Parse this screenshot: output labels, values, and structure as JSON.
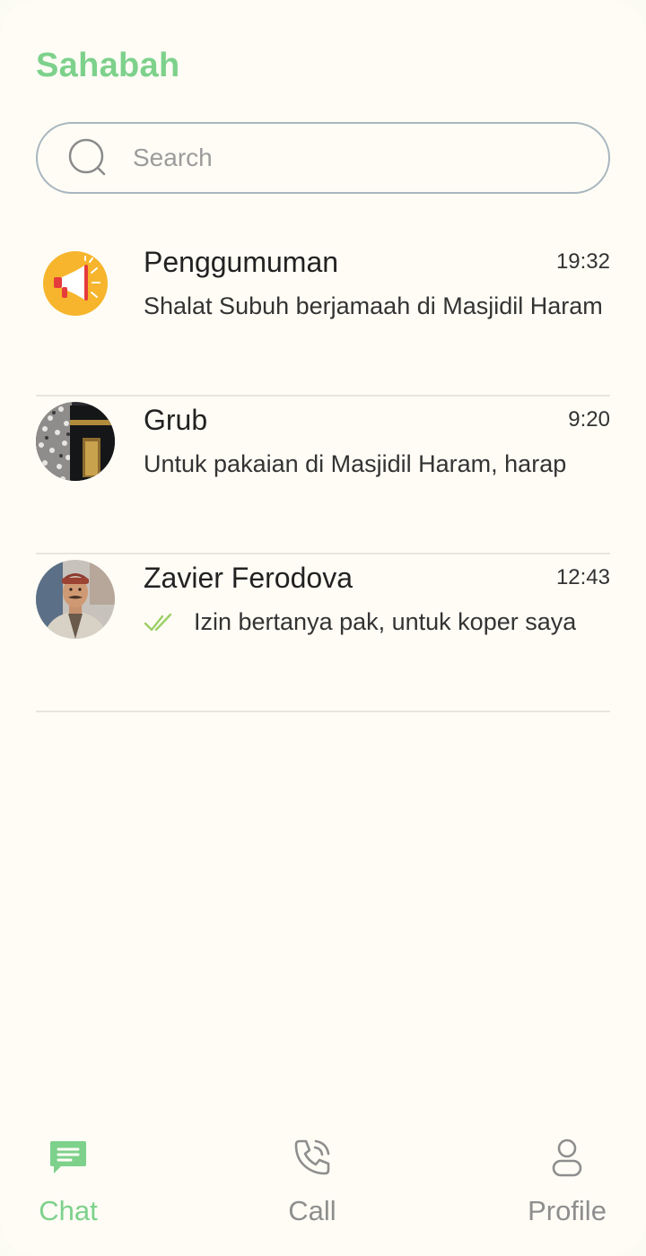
{
  "app": {
    "title": "Sahabah"
  },
  "search": {
    "placeholder": "Search",
    "value": ""
  },
  "chats": [
    {
      "name": "Penggumuman",
      "time": "19:32",
      "preview": "Shalat Subuh berjamaah di Masjidil Haram",
      "avatar": "megaphone-icon",
      "read_receipt": false
    },
    {
      "name": "Grub",
      "time": "9:20",
      "preview": "Untuk pakaian di Masjidil Haram, harap",
      "avatar": "kaaba-photo",
      "read_receipt": false
    },
    {
      "name": "Zavier Ferodova",
      "time": "12:43",
      "preview": "Izin bertanya pak, untuk koper saya",
      "avatar": "person-photo",
      "read_receipt": true
    }
  ],
  "nav": {
    "items": [
      {
        "label": "Chat",
        "icon": "chat-bubble-icon",
        "active": true
      },
      {
        "label": "Call",
        "icon": "phone-icon",
        "active": false
      },
      {
        "label": "Profile",
        "icon": "user-icon",
        "active": false
      }
    ]
  },
  "colors": {
    "accent": "#7dd18b",
    "background": "#fefcf5",
    "inactive": "#8e8e8e",
    "check": "#9ccf65",
    "announcement": "#f6b52c"
  }
}
